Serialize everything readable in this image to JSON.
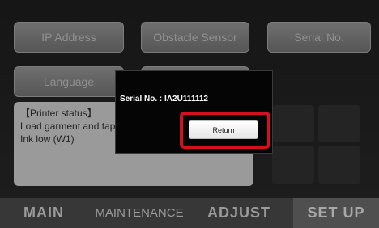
{
  "buttons": {
    "ip_address": "IP Address",
    "obstacle_sensor": "Obstacle Sensor",
    "serial_no": "Serial No.",
    "language": "Language"
  },
  "status": {
    "header": "【Printer status】",
    "line1": "Load garment and tap",
    "line2": "Ink low (W1)"
  },
  "dialog": {
    "serial_text": "Serial No. : IA2U111112",
    "return_label": "Return"
  },
  "tabs": {
    "main": "MAIN",
    "maintenance": "MAINTENANCE",
    "adjust": "ADJUST",
    "setup": "SET UP",
    "active": "setup"
  },
  "colors": {
    "highlight": "#d3101c",
    "panel": "#9a9a9a",
    "button": "#666666"
  }
}
